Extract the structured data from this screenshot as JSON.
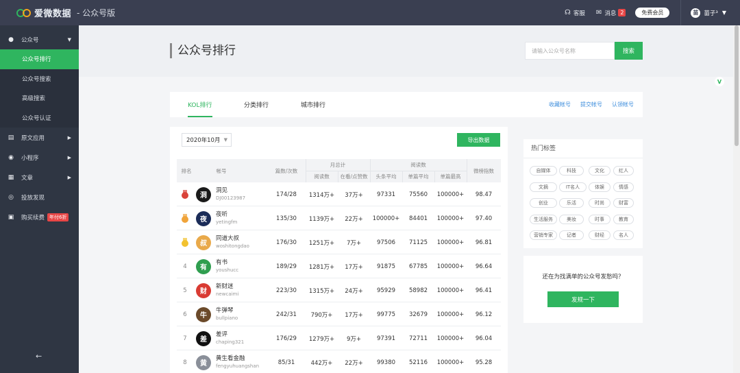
{
  "header": {
    "brand": "爱微数据",
    "edition": "- 公众号版",
    "service_label": "客服",
    "message_label": "消息",
    "message_count": "2",
    "member_button": "免费会员",
    "user_avatar_text": "苗",
    "user_name": "苗子³"
  },
  "sidebar": {
    "groups": [
      {
        "label": "公众号",
        "icon": "wechat-icon"
      },
      {
        "label": "原文应用",
        "icon": "document-icon"
      },
      {
        "label": "小程序",
        "icon": "mini-program-icon"
      },
      {
        "label": "文章",
        "icon": "article-icon"
      },
      {
        "label": "投放发现",
        "icon": "compass-icon"
      },
      {
        "label": "购买续费",
        "icon": "shop-icon"
      }
    ],
    "subitems": [
      "公众号排行",
      "公众号搜索",
      "高级搜索",
      "公众号认证"
    ],
    "promo_tag": "年付6折",
    "collapse_icon": "←"
  },
  "page": {
    "title": "公众号排行",
    "search_placeholder": "请输入公众号名称",
    "search_button": "搜索"
  },
  "tabs": {
    "items": [
      "KOL排行",
      "分类排行",
      "城市排行"
    ],
    "active": 0,
    "links": [
      "收藏帐号",
      "提交帐号",
      "认领帐号"
    ]
  },
  "ranking": {
    "month": "2020年10月",
    "export_button": "导出数据",
    "headers": {
      "rank": "排名",
      "account": "帐号",
      "publish": "篇数/次数",
      "monthly_total": "月总计",
      "reads": "阅读数",
      "likes": "在看/点赞数",
      "read_group": "阅读数",
      "headline_avg": "头条平均",
      "single_avg": "单篇平均",
      "single_max": "单篇最高",
      "index": "微榜指数"
    },
    "rows": [
      {
        "rank": "1",
        "name": "洞见",
        "id": "DJ00123987",
        "publish": "174/28",
        "reads": "1314万+",
        "likes": "37万+",
        "headline": "97331",
        "avg": "75560",
        "max": "100000+",
        "index": "98.47",
        "avatar_text": "洞",
        "avatar_color": "#1a1a1a"
      },
      {
        "rank": "2",
        "name": "夜听",
        "id": "yetingfm",
        "publish": "135/30",
        "reads": "1139万+",
        "likes": "22万+",
        "headline": "100000+",
        "avg": "84401",
        "max": "100000+",
        "index": "97.40",
        "avatar_text": "夜",
        "avatar_color": "#1b2c58"
      },
      {
        "rank": "3",
        "name": "同道大叔",
        "id": "woshitongdao",
        "publish": "176/30",
        "reads": "1251万+",
        "likes": "7万+",
        "headline": "97506",
        "avg": "71125",
        "max": "100000+",
        "index": "96.81",
        "avatar_text": "叔",
        "avatar_color": "#e9a94a"
      },
      {
        "rank": "4",
        "name": "有书",
        "id": "youshucc",
        "publish": "189/29",
        "reads": "1281万+",
        "likes": "17万+",
        "headline": "91875",
        "avg": "67785",
        "max": "100000+",
        "index": "96.64",
        "avatar_text": "有",
        "avatar_color": "#2f9e4f"
      },
      {
        "rank": "5",
        "name": "新财迷",
        "id": "newcaimi",
        "publish": "223/30",
        "reads": "1315万+",
        "likes": "24万+",
        "headline": "95929",
        "avg": "58982",
        "max": "100000+",
        "index": "96.41",
        "avatar_text": "财",
        "avatar_color": "#d93b33"
      },
      {
        "rank": "6",
        "name": "牛弹琴",
        "id": "bullpiano",
        "publish": "242/31",
        "reads": "790万+",
        "likes": "17万+",
        "headline": "99775",
        "avg": "32679",
        "max": "100000+",
        "index": "96.12",
        "avatar_text": "牛",
        "avatar_color": "#6b4a2a"
      },
      {
        "rank": "7",
        "name": "差评",
        "id": "chaping321",
        "publish": "176/29",
        "reads": "1279万+",
        "likes": "9万+",
        "headline": "97391",
        "avg": "72711",
        "max": "100000+",
        "index": "96.04",
        "avatar_text": "差",
        "avatar_color": "#111111"
      },
      {
        "rank": "8",
        "name": "黄生看金融",
        "id": "fengyuhuangshan",
        "publish": "85/31",
        "reads": "442万+",
        "likes": "22万+",
        "headline": "99380",
        "avg": "52116",
        "max": "100000+",
        "index": "95.28",
        "avatar_text": "黄",
        "avatar_color": "#8a8f99"
      }
    ],
    "medal_colors": [
      "#d9433a",
      "#f0a43a",
      "#f2c230"
    ]
  },
  "hot_tags": {
    "title": "热门标签",
    "tags": [
      "自媒体",
      "科技",
      "文化",
      "红人",
      "文摘",
      "IT名人",
      "体娱",
      "情感",
      "创业",
      "乐活",
      "时尚",
      "财富",
      "生活服务",
      "美妆",
      "时事",
      "教育",
      "营销专家",
      "记者",
      "财经",
      "名人"
    ]
  },
  "ask": {
    "text": "还在为找满单的公众号发愁吗？",
    "button": "发规一下"
  },
  "floating_badge": "V",
  "colors": {
    "accent": "#2fb55f",
    "topbar": "#3a3f51",
    "sidebar": "#2f3643",
    "link": "#3e8edc"
  }
}
